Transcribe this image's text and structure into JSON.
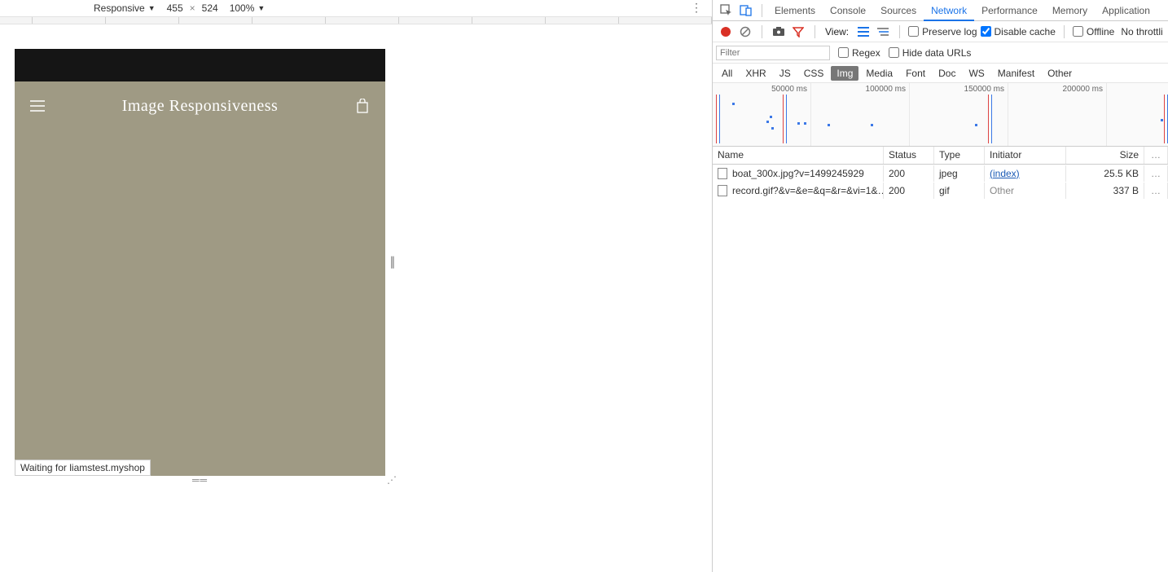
{
  "device_toolbar": {
    "mode": "Responsive",
    "width": "455",
    "height": "524",
    "dim_sep": "×",
    "zoom": "100%"
  },
  "site": {
    "title": "Image Responsiveness",
    "status": "Waiting for liamstest.myshop"
  },
  "devtools": {
    "tabs": [
      "Elements",
      "Console",
      "Sources",
      "Network",
      "Performance",
      "Memory",
      "Application"
    ],
    "active_tab": "Network",
    "toolbar": {
      "view_label": "View:",
      "preserve_log": "Preserve log",
      "disable_cache": "Disable cache",
      "offline": "Offline",
      "no_throttling": "No throttli"
    },
    "filter": {
      "placeholder": "Filter",
      "regex": "Regex",
      "hide_data_urls": "Hide data URLs"
    },
    "chips": [
      "All",
      "XHR",
      "JS",
      "CSS",
      "Img",
      "Media",
      "Font",
      "Doc",
      "WS",
      "Manifest",
      "Other"
    ],
    "chip_active": "Img",
    "waterfall_labels": [
      "50000 ms",
      "100000 ms",
      "150000 ms",
      "200000 ms"
    ],
    "columns": {
      "name": "Name",
      "status": "Status",
      "type": "Type",
      "initiator": "Initiator",
      "size": "Size",
      "more": "…"
    },
    "rows": [
      {
        "name": "boat_300x.jpg?v=1499245929",
        "status": "200",
        "type": "jpeg",
        "initiator": "(index)",
        "initiator_link": true,
        "size": "25.5 KB",
        "more": "…"
      },
      {
        "name": "record.gif?&v=&e=&q=&r=&vi=1&…",
        "status": "200",
        "type": "gif",
        "initiator": "Other",
        "initiator_link": false,
        "size": "337 B",
        "more": "…"
      }
    ]
  }
}
